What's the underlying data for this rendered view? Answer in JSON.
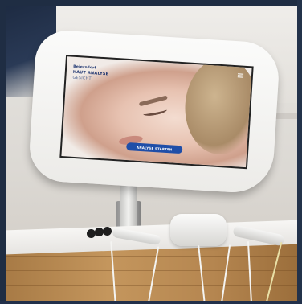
{
  "screen": {
    "brand_line1": "Beiersdorf",
    "brand_line2": "HAUT ANALYSE",
    "brand_line3": "GESICHT",
    "start_button": "ANALYSE STARTEN"
  }
}
